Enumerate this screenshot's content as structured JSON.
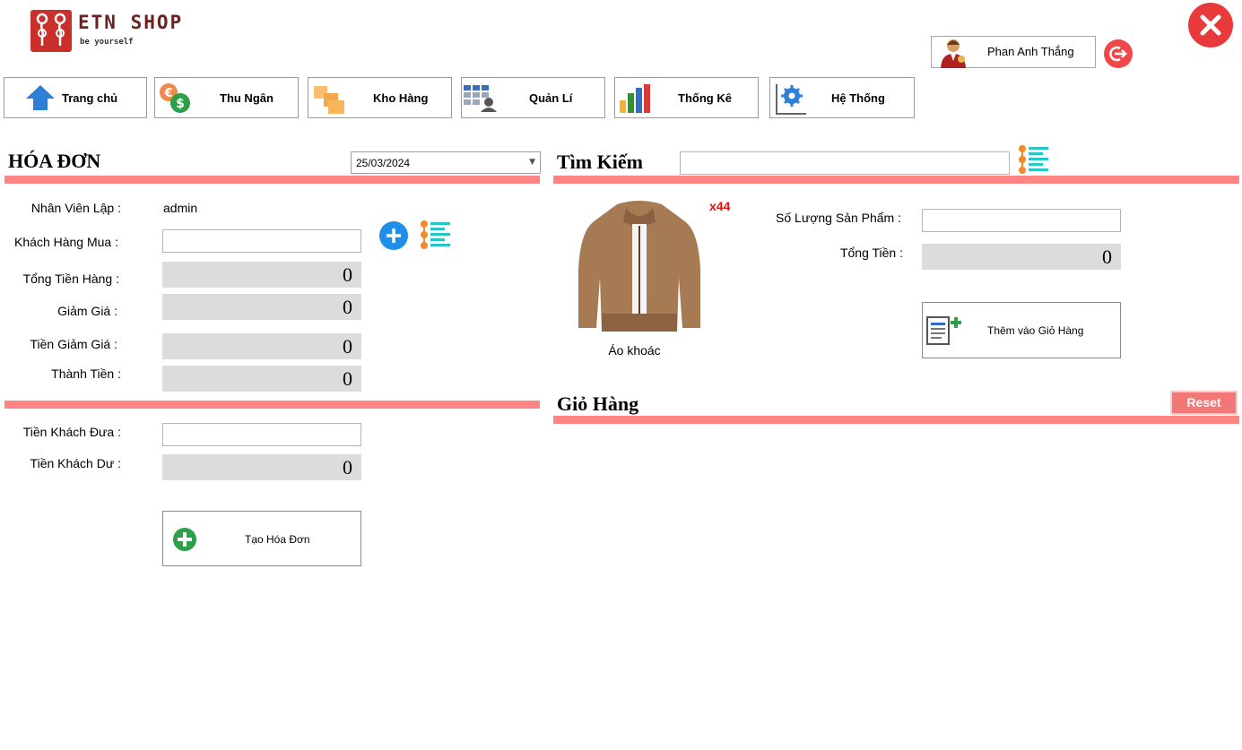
{
  "app": {
    "logo_title": "ETN SHOP",
    "logo_subtitle": "be yourself"
  },
  "user": {
    "name": "Phan Anh Thắng"
  },
  "nav": [
    {
      "label": "Trang chủ",
      "icon": "home-icon"
    },
    {
      "label": "Thu Ngân",
      "icon": "cashier-icon"
    },
    {
      "label": "Kho Hàng",
      "icon": "warehouse-icon"
    },
    {
      "label": "Quản Lí",
      "icon": "manage-icon"
    },
    {
      "label": "Thống Kê",
      "icon": "statistics-icon"
    },
    {
      "label": "Hệ Thống",
      "icon": "system-icon"
    }
  ],
  "invoice": {
    "title": "HÓA ĐƠN",
    "date": "25/03/2024",
    "employee_label": "Nhân Viên Lập :",
    "employee_value": "admin",
    "customer_label": "Khách Hàng Mua :",
    "customer_value": "",
    "subtotal_label": "Tổng Tiền Hàng :",
    "subtotal_value": "0",
    "discount_label": "Giảm Giá :",
    "discount_value": "0",
    "discount_amount_label": "Tiền Giảm Giá :",
    "discount_amount_value": "0",
    "total_label": "Thành Tiền :",
    "total_value": "0",
    "cash_given_label": "Tiền Khách Đưa :",
    "cash_given_value": "",
    "change_label": "Tiền Khách Dư :",
    "change_value": "0",
    "create_button": "Tạo Hóa Đơn"
  },
  "search": {
    "title": "Tìm Kiếm",
    "value": ""
  },
  "product": {
    "name": "Áo khoác",
    "stock_badge": "x44",
    "quantity_label": "Số Lượng Sản Phẩm :",
    "quantity_value": "",
    "total_label": "Tổng Tiền :",
    "total_value": "0",
    "add_to_cart_button": "Thêm vào Giỏ Hàng"
  },
  "cart": {
    "title": "Giỏ Hàng",
    "reset_button": "Reset"
  },
  "colors": {
    "accent_bar": "#ff8585",
    "reset_bg": "#f27777",
    "badge": "#e81010",
    "readonly_bg": "#dcdcdc"
  }
}
